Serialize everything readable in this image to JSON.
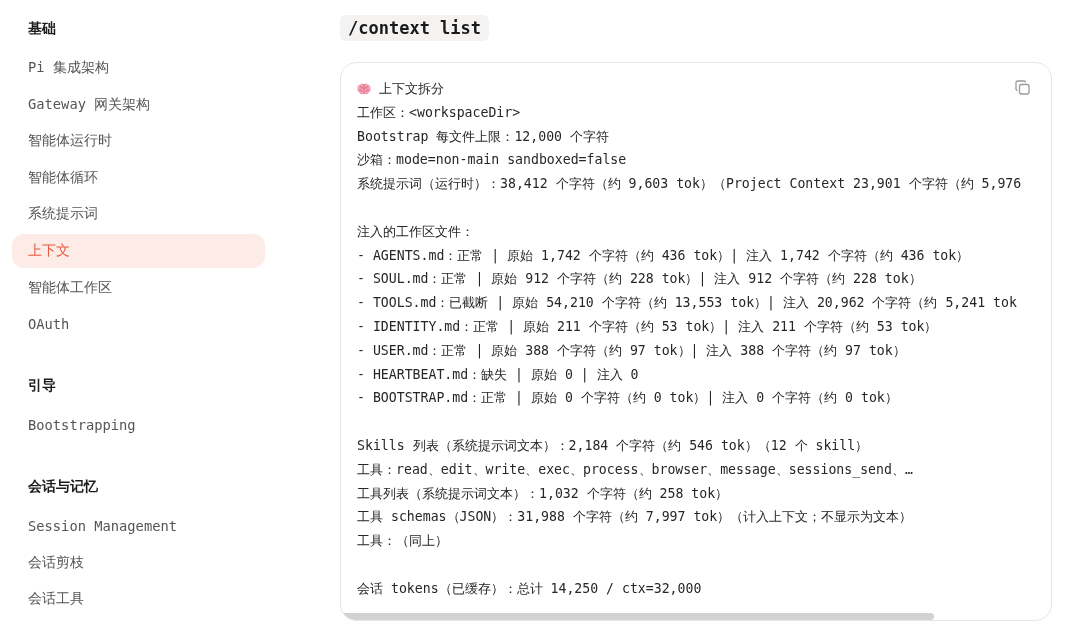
{
  "sidebar": {
    "sections": [
      {
        "title": "基础",
        "items": [
          {
            "label": "Pi 集成架构",
            "selected": false
          },
          {
            "label": "Gateway 网关架构",
            "selected": false
          },
          {
            "label": "智能体运行时",
            "selected": false
          },
          {
            "label": "智能体循环",
            "selected": false
          },
          {
            "label": "系统提示词",
            "selected": false
          },
          {
            "label": "上下文",
            "selected": true
          },
          {
            "label": "智能体工作区",
            "selected": false
          },
          {
            "label": "OAuth",
            "selected": false
          }
        ]
      },
      {
        "title": "引导",
        "items": [
          {
            "label": "Bootstrapping",
            "selected": false
          }
        ]
      },
      {
        "title": "会话与记忆",
        "items": [
          {
            "label": "Session Management",
            "selected": false
          },
          {
            "label": "会话剪枝",
            "selected": false
          },
          {
            "label": "会话工具",
            "selected": false
          }
        ]
      }
    ]
  },
  "command": "/context list",
  "output": {
    "lines": [
      {
        "kind": "title",
        "text": "上下文拆分"
      },
      {
        "kind": "text",
        "text": "工作区：<workspaceDir>"
      },
      {
        "kind": "text",
        "text": "Bootstrap 每文件上限：12,000 个字符"
      },
      {
        "kind": "text",
        "text": "沙箱：mode=non-main sandboxed=false"
      },
      {
        "kind": "text",
        "text": "系统提示词（运行时）：38,412 个字符（约 9,603 tok）（Project Context 23,901 个字符（约 5,976"
      },
      {
        "kind": "blank"
      },
      {
        "kind": "text",
        "text": "注入的工作区文件："
      },
      {
        "kind": "text",
        "text": "- AGENTS.md：正常 | 原始 1,742 个字符（约 436 tok）| 注入 1,742 个字符（约 436 tok）"
      },
      {
        "kind": "text",
        "text": "- SOUL.md：正常 | 原始 912 个字符（约 228 tok）| 注入 912 个字符（约 228 tok）"
      },
      {
        "kind": "text",
        "text": "- TOOLS.md：已截断 | 原始 54,210 个字符（约 13,553 tok）| 注入 20,962 个字符（约 5,241 tok"
      },
      {
        "kind": "text",
        "text": "- IDENTITY.md：正常 | 原始 211 个字符（约 53 tok）| 注入 211 个字符（约 53 tok）"
      },
      {
        "kind": "text",
        "text": "- USER.md：正常 | 原始 388 个字符（约 97 tok）| 注入 388 个字符（约 97 tok）"
      },
      {
        "kind": "text",
        "text": "- HEARTBEAT.md：缺失 | 原始 0 | 注入 0"
      },
      {
        "kind": "text",
        "text": "- BOOTSTRAP.md：正常 | 原始 0 个字符（约 0 tok）| 注入 0 个字符（约 0 tok）"
      },
      {
        "kind": "blank"
      },
      {
        "kind": "text",
        "text": "Skills 列表（系统提示词文本）：2,184 个字符（约 546 tok）（12 个 skill）"
      },
      {
        "kind": "text",
        "text": "工具：read、edit、write、exec、process、browser、message、sessions_send、…"
      },
      {
        "kind": "text",
        "text": "工具列表（系统提示词文本）：1,032 个字符（约 258 tok）"
      },
      {
        "kind": "text",
        "text": "工具 schemas（JSON）：31,988 个字符（约 7,997 tok）（计入上下文；不显示为文本）"
      },
      {
        "kind": "text",
        "text": "工具：（同上）"
      },
      {
        "kind": "blank"
      },
      {
        "kind": "text",
        "text": "会话 tokens（已缓存）：总计 14,250 / ctx=32,000"
      }
    ]
  }
}
